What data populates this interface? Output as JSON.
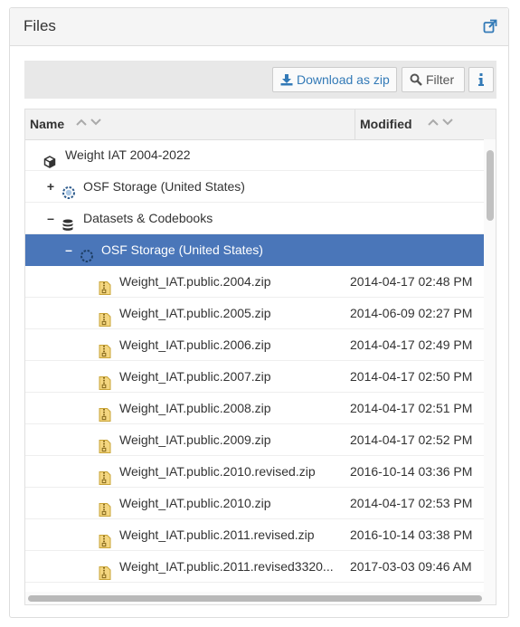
{
  "panel": {
    "title": "Files"
  },
  "toolbar": {
    "download_label": "Download as zip",
    "filter_label": "Filter"
  },
  "columns": {
    "name": "Name",
    "modified": "Modified"
  },
  "tree": {
    "project": "Weight IAT 2004-2022",
    "storage1": "OSF Storage (United States)",
    "component": "Datasets & Codebooks",
    "storage2": "OSF Storage (United States)"
  },
  "files": [
    {
      "name": "Weight_IAT.public.2004.zip",
      "modified": "2014-04-17 02:48 PM"
    },
    {
      "name": "Weight_IAT.public.2005.zip",
      "modified": "2014-06-09 02:27 PM"
    },
    {
      "name": "Weight_IAT.public.2006.zip",
      "modified": "2014-04-17 02:49 PM"
    },
    {
      "name": "Weight_IAT.public.2007.zip",
      "modified": "2014-04-17 02:50 PM"
    },
    {
      "name": "Weight_IAT.public.2008.zip",
      "modified": "2014-04-17 02:51 PM"
    },
    {
      "name": "Weight_IAT.public.2009.zip",
      "modified": "2014-04-17 02:52 PM"
    },
    {
      "name": "Weight_IAT.public.2010.revised.zip",
      "modified": "2016-10-14 03:36 PM"
    },
    {
      "name": "Weight_IAT.public.2010.zip",
      "modified": "2014-04-17 02:53 PM"
    },
    {
      "name": "Weight_IAT.public.2011.revised.zip",
      "modified": "2016-10-14 03:38 PM"
    },
    {
      "name": "Weight_IAT.public.2011.revised3320...",
      "modified": "2017-03-03 09:46 AM"
    }
  ],
  "icons": {
    "external": "external-link-icon",
    "download": "download-icon",
    "filter": "search-icon",
    "info": "info-icon",
    "project": "cube-icon",
    "storage": "osf-storage-icon",
    "component": "database-icon",
    "file": "zip-file-icon"
  },
  "colors": {
    "accent": "#337ab7",
    "selected_row": "#4a76b9",
    "zip_icon": "#e8c24a"
  }
}
